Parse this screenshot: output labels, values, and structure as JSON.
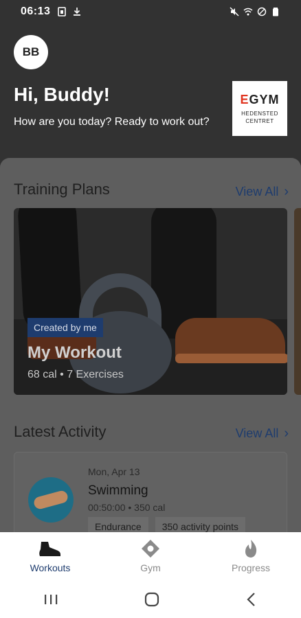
{
  "status_bar": {
    "time": "06:13",
    "left_icons": [
      "sim-icon",
      "download-icon"
    ],
    "right_icons": [
      "mute-icon",
      "wifi-icon",
      "do-not-disturb-icon",
      "battery-icon"
    ]
  },
  "header": {
    "avatar_initials": "BB",
    "greeting": "Hi, Buddy!",
    "subtitle": "How are you today? Ready to work out?",
    "logo": {
      "brand_first_letter": "E",
      "brand_rest": "GYM",
      "location_line1": "HEDENSTED",
      "location_line2": "CENTRET"
    }
  },
  "training_plans": {
    "title": "Training Plans",
    "view_all": "View All",
    "plan": {
      "badge": "Created by me",
      "name": "My Workout",
      "meta": "68 cal • 7 Exercises"
    }
  },
  "latest_activity": {
    "title": "Latest Activity",
    "view_all": "View All",
    "item": {
      "date": "Mon, Apr 13",
      "name": "Swimming",
      "meta": "00:50:00 • 350 cal",
      "tags": [
        "Endurance",
        "350 activity points"
      ]
    }
  },
  "bottom_nav": {
    "items": [
      {
        "label": "Workouts",
        "icon": "shoe-icon",
        "active": true
      },
      {
        "label": "Gym",
        "icon": "location-icon",
        "active": false
      },
      {
        "label": "Progress",
        "icon": "flame-icon",
        "active": false
      }
    ]
  },
  "colors": {
    "accent": "#1e3c6e",
    "header_bg": "#323232",
    "brand_red": "#e0341f"
  }
}
